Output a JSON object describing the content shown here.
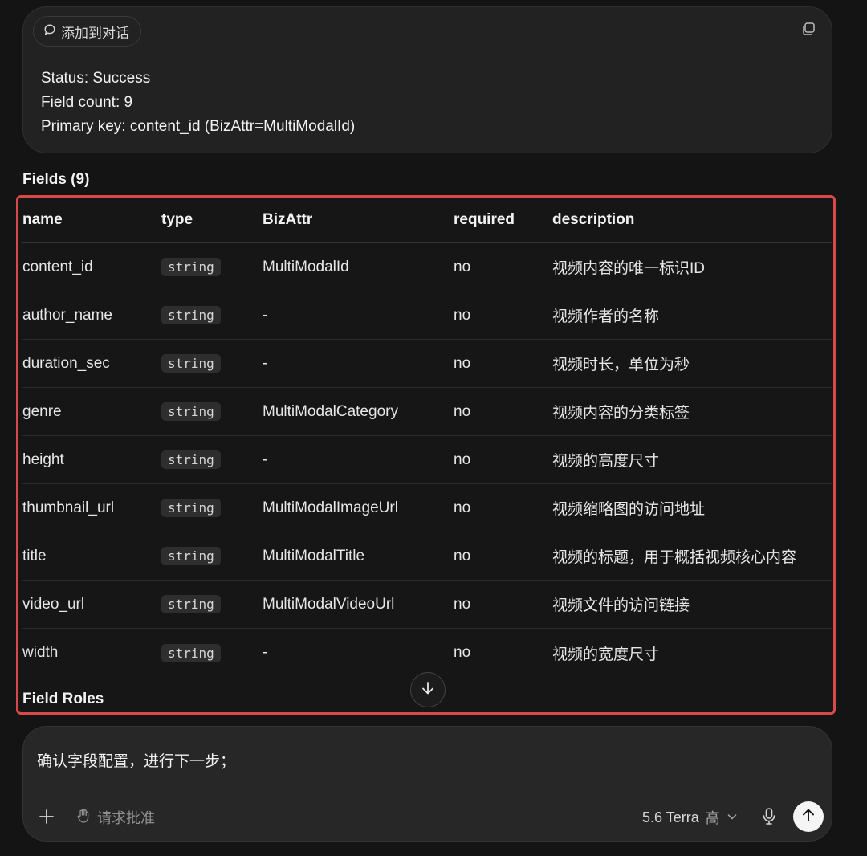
{
  "status_card": {
    "chip_icon": "chat-bubble-icon",
    "chip_label": "添加到对话",
    "copy_icon": "copy-icon",
    "lines": [
      "Status: Success",
      "Field count: 9",
      "Primary key: content_id (BizAttr=MultiModalId)"
    ]
  },
  "fields_heading": "Fields (9)",
  "table": {
    "headers": [
      "name",
      "type",
      "BizAttr",
      "required",
      "description"
    ],
    "rows": [
      {
        "name": "content_id",
        "type": "string",
        "bizattr": "MultiModalId",
        "required": "no",
        "description": "视频内容的唯一标识ID"
      },
      {
        "name": "author_name",
        "type": "string",
        "bizattr": "-",
        "required": "no",
        "description": "视频作者的名称"
      },
      {
        "name": "duration_sec",
        "type": "string",
        "bizattr": "-",
        "required": "no",
        "description": "视频时长，单位为秒"
      },
      {
        "name": "genre",
        "type": "string",
        "bizattr": "MultiModalCategory",
        "required": "no",
        "description": "视频内容的分类标签"
      },
      {
        "name": "height",
        "type": "string",
        "bizattr": "-",
        "required": "no",
        "description": "视频的高度尺寸"
      },
      {
        "name": "thumbnail_url",
        "type": "string",
        "bizattr": "MultiModalImageUrl",
        "required": "no",
        "description": "视频缩略图的访问地址"
      },
      {
        "name": "title",
        "type": "string",
        "bizattr": "MultiModalTitle",
        "required": "no",
        "description": "视频的标题，用于概括视频核心内容"
      },
      {
        "name": "video_url",
        "type": "string",
        "bizattr": "MultiModalVideoUrl",
        "required": "no",
        "description": "视频文件的访问链接"
      },
      {
        "name": "width",
        "type": "string",
        "bizattr": "-",
        "required": "no",
        "description": "视频的宽度尺寸"
      }
    ],
    "highlight_color": "#d7494b"
  },
  "field_roles_heading": "Field Roles",
  "scroll_icon": "arrow-down-icon",
  "composer": {
    "text": "确认字段配置，进行下一步；",
    "plus_icon": "plus-icon",
    "approve_icon": "hand-icon",
    "approve_label": "请求批准",
    "model_name": "5.6 Terra",
    "model_level": "高",
    "chevron_icon": "chevron-down-icon",
    "mic_icon": "microphone-icon",
    "send_icon": "arrow-up-icon"
  }
}
